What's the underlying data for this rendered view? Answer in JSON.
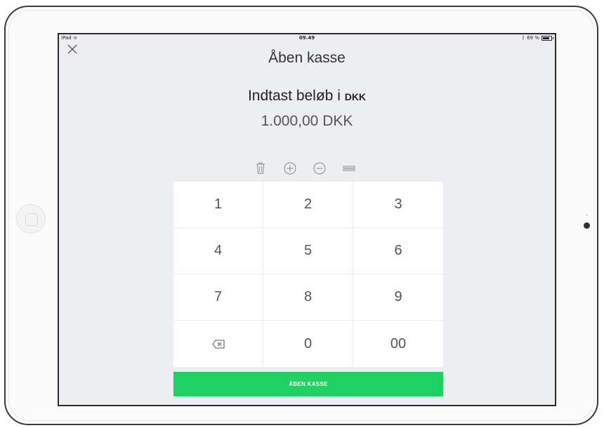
{
  "status_bar": {
    "device": "iPad",
    "time": "09.49",
    "battery": "69 %",
    "battery_level": 0.69
  },
  "header": {
    "title": "Åben kasse",
    "close_icon": "close-icon"
  },
  "entry": {
    "prompt": "Indtast beløb i",
    "currency": "DKK",
    "amount": "1.000,00 DKK"
  },
  "tools": [
    {
      "name": "trash-icon"
    },
    {
      "name": "plus-circle-icon"
    },
    {
      "name": "minus-circle-icon"
    },
    {
      "name": "equals-icon"
    }
  ],
  "keypad": {
    "keys": [
      "1",
      "2",
      "3",
      "4",
      "5",
      "6",
      "7",
      "8",
      "9",
      "⌫",
      "0",
      "00"
    ]
  },
  "action": {
    "label": "ÅBEN KASSE",
    "color": "#1fd162"
  }
}
